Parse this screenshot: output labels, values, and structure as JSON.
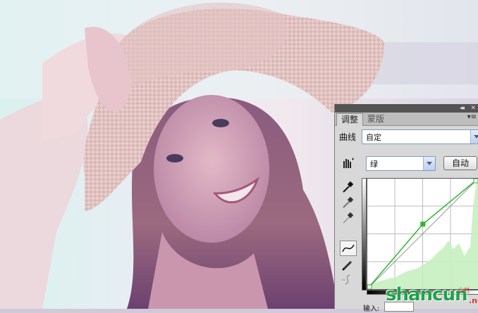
{
  "panel": {
    "collapse_glyph": "◂◂",
    "close_glyph": "✕",
    "tabs": [
      {
        "label": "调整",
        "active": true
      },
      {
        "label": "蒙版",
        "active": false
      }
    ],
    "menu_glyph": "▾≡",
    "preset_label": "曲线",
    "preset_value": "自定",
    "channel_value": "绿",
    "auto_label": "自动",
    "input_label": "输入:"
  },
  "tools": [
    {
      "name": "hand-target-icon"
    },
    {
      "name": "black-eyedropper-icon"
    },
    {
      "name": "gray-eyedropper-icon"
    },
    {
      "name": "white-eyedropper-icon"
    },
    {
      "name": "curve-point-tool-icon",
      "active": true
    },
    {
      "name": "pencil-icon"
    },
    {
      "name": "smooth-curve-icon"
    }
  ],
  "curve": {
    "channel_color": "#2db82d",
    "points": [
      [
        0,
        0
      ],
      [
        128,
        150
      ],
      [
        255,
        255
      ]
    ]
  },
  "watermark": {
    "brand": "shancun",
    "suffix": ".net",
    "cn": "山村"
  }
}
